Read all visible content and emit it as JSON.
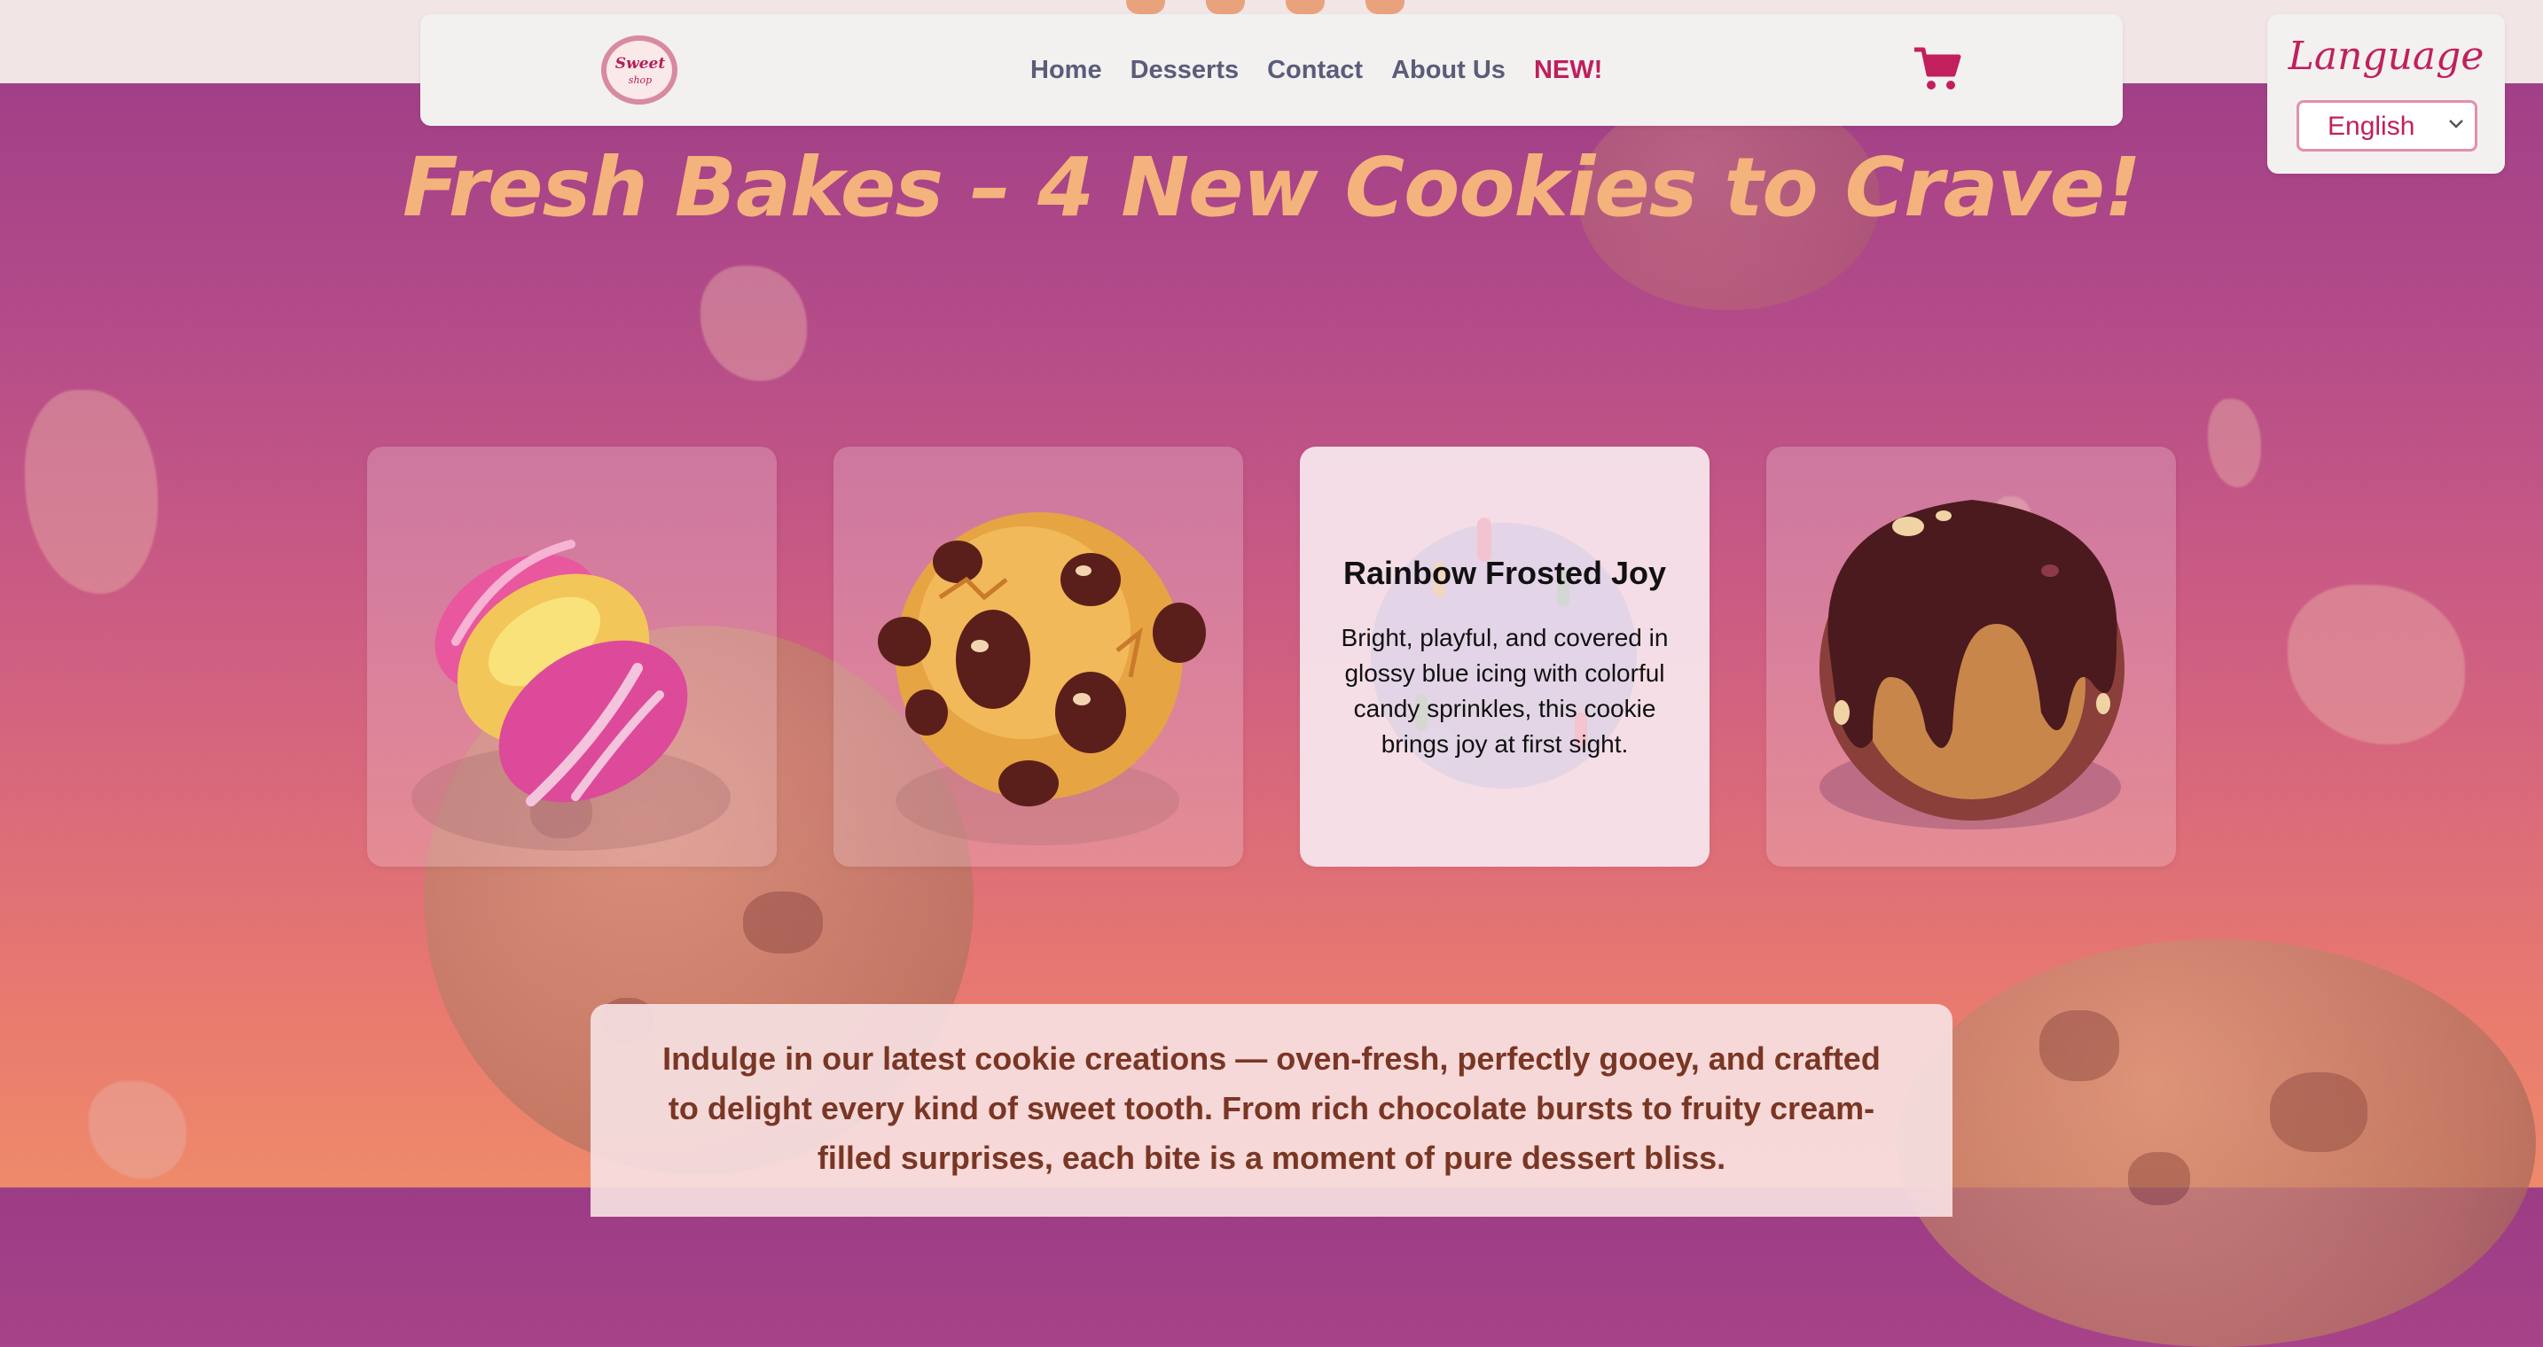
{
  "brand": {
    "logo_line1": "Sweet",
    "logo_line2": "shop"
  },
  "nav": {
    "links": [
      {
        "label": "Home"
      },
      {
        "label": "Desserts"
      },
      {
        "label": "Contact"
      },
      {
        "label": "About Us"
      },
      {
        "label": "NEW!"
      }
    ],
    "cart_icon": "cart-icon"
  },
  "language": {
    "title": "Language",
    "selected": "English",
    "chevron_icon": "chevron-down-icon"
  },
  "hero": {
    "headline": "Fresh Bakes – 4 New Cookies to Crave!"
  },
  "cards": [
    {
      "image": "pink-yellow-swirl-cookie"
    },
    {
      "image": "chocolate-chip-cookie"
    },
    {
      "image": "rainbow-sprinkle-cookie",
      "title": "Rainbow Frosted Joy",
      "description": "Bright, playful, and covered in glossy blue icing with colorful candy sprinkles, this cookie brings joy at first sight."
    },
    {
      "image": "chocolate-drizzle-cookie"
    }
  ],
  "intro": {
    "text": "Indulge in our latest cookie creations — oven-fresh, perfectly gooey, and crafted to delight every kind of sweet tooth. From rich chocolate bursts to fruity cream-filled surprises, each bite is a moment of pure dessert bliss."
  },
  "colors": {
    "accent": "#c21f5d",
    "headline": "#f4b27c",
    "nav_text": "#5a5c7a",
    "intro_text": "#7a3624"
  }
}
